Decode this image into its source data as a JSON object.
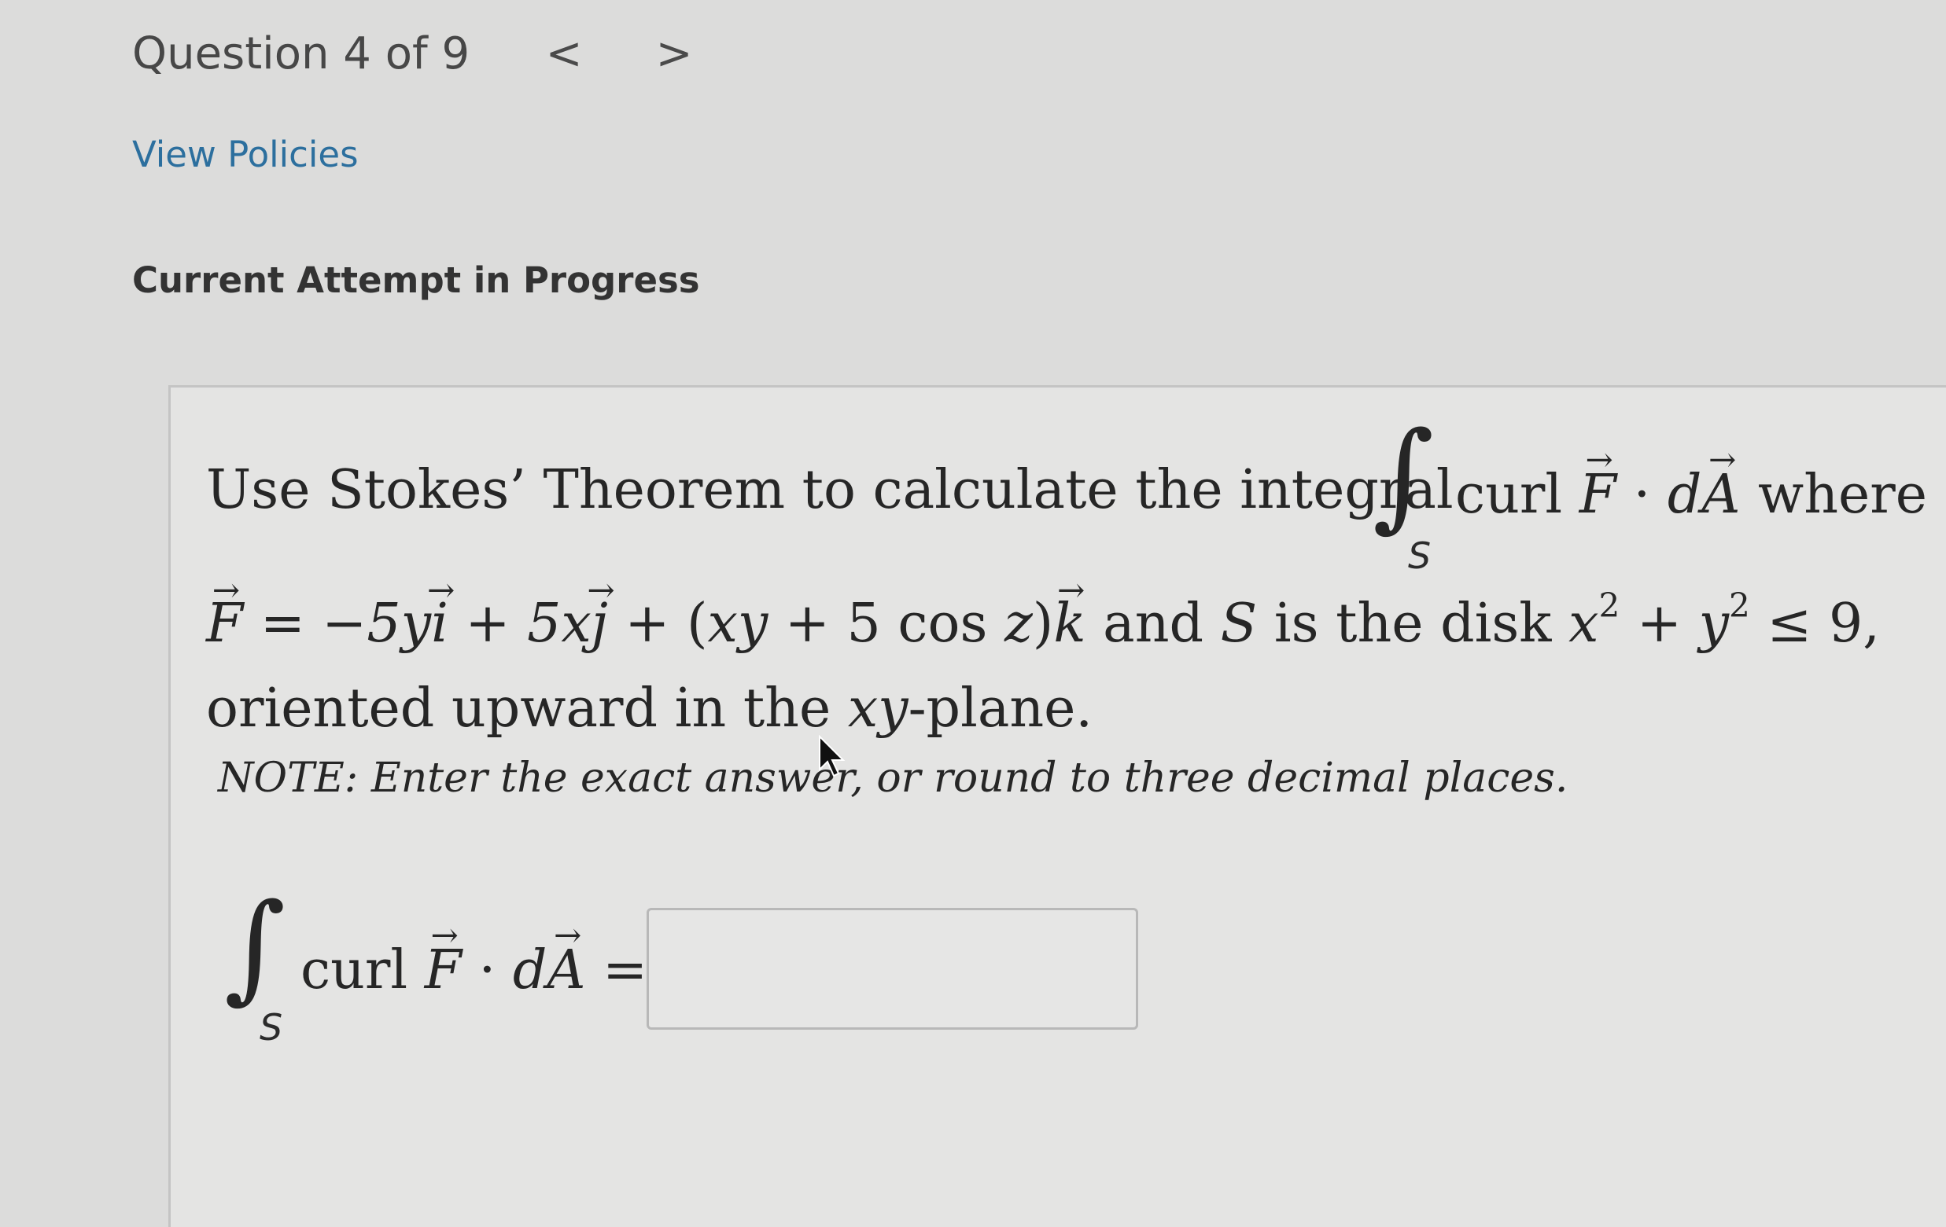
{
  "header": {
    "question_counter": "Question 4 of 9",
    "prev_arrow": "<",
    "next_arrow": ">"
  },
  "links": {
    "view_policies": "View Policies"
  },
  "status": {
    "attempt": "Current Attempt in Progress"
  },
  "question": {
    "intro": "Use Stokes’ Theorem to calculate the integral",
    "integral_subscript": "S",
    "integrand_curl": "curl",
    "integrand_F": "F",
    "integrand_dot": "·",
    "integrand_d": "d",
    "integrand_A": "A",
    "where": "where",
    "field_lhs": "F",
    "field_eq": "=",
    "field_t1": "−5y",
    "unit_i": "i",
    "field_plus1": "+",
    "field_t2": "5x",
    "unit_j": "j",
    "field_plus2": "+",
    "field_t3_open": "(",
    "field_t3_xy": "xy",
    "field_t3_plus": " + 5",
    "field_t3_cos": "cos",
    "field_t3_z": "z",
    "field_t3_close": ")",
    "unit_k": "k",
    "and_text": "and",
    "surface": "S",
    "is_the_disk": "is the disk",
    "disk_x": "x",
    "disk_exp1": "2",
    "disk_plus": "+",
    "disk_y": "y",
    "disk_exp2": "2",
    "disk_leq": "≤",
    "disk_r": "9,",
    "line3_a": "oriented upward in the",
    "line3_xy": "xy",
    "line3_b": "-plane.",
    "note": "NOTE: Enter the exact answer, or round to three decimal places."
  },
  "answer": {
    "integral_subscript": "S",
    "curl": "curl",
    "F": "F",
    "dot": "·",
    "d": "d",
    "A": "A",
    "equals": "=",
    "input_value": ""
  }
}
